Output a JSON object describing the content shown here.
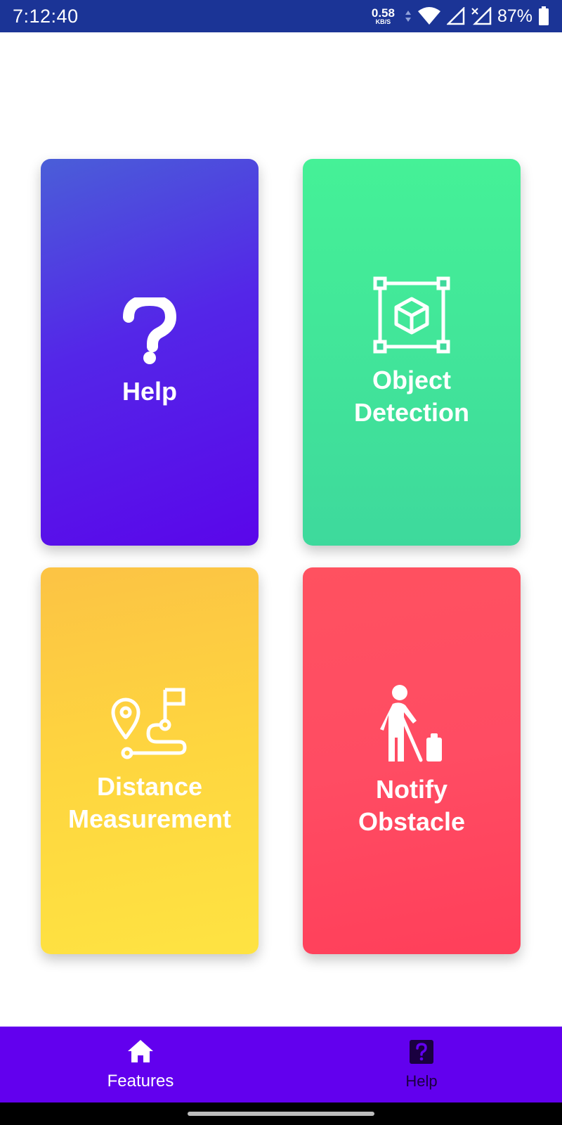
{
  "status_bar": {
    "time": "7:12:40",
    "net_speed_value": "0.58",
    "net_speed_unit": "KB/S",
    "battery_percent": "87%",
    "icons": [
      "data-arrows-icon",
      "wifi-icon",
      "signal-icon",
      "signal-no-service-icon",
      "battery-icon"
    ]
  },
  "cards": {
    "help": {
      "label": "Help",
      "icon": "question-mark-icon",
      "color_start": "#4a5ed8",
      "color_end": "#5a06ea"
    },
    "object_detection": {
      "line1": "Object",
      "line2": "Detection",
      "icon": "3d-bounding-box-icon",
      "color_start": "#45f197",
      "color_end": "#3ed99c"
    },
    "distance_measurement": {
      "line1": "Distance",
      "line2": "Measurement",
      "icon": "route-map-icon",
      "color_start": "#fcc344",
      "color_end": "#fee342"
    },
    "notify_obstacle": {
      "line1": "Notify",
      "line2": "Obstacle",
      "icon": "blind-person-obstacle-icon",
      "color_start": "#ff5160",
      "color_end": "#ff3f5a"
    }
  },
  "bottom_nav": {
    "background": "#6200ee",
    "items": [
      {
        "label": "Features",
        "icon": "home-icon",
        "active": true
      },
      {
        "label": "Help",
        "icon": "help-icon",
        "active": false
      }
    ]
  }
}
